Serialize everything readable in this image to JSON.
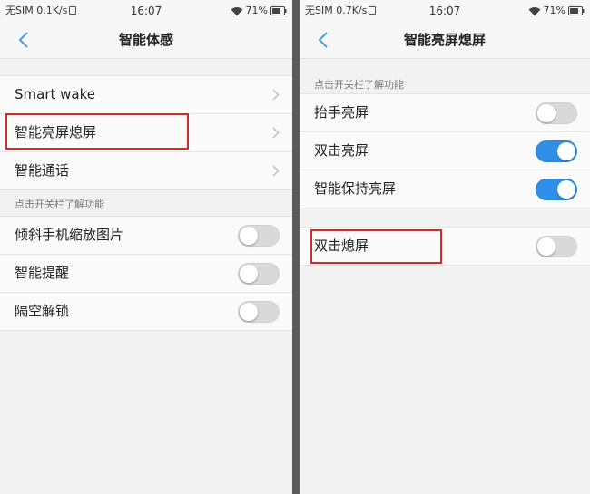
{
  "left": {
    "status": {
      "carrier": "无SIM",
      "speed": "0.1K/s",
      "time": "16:07",
      "battery": "71%"
    },
    "title": "智能体感",
    "group1": [
      {
        "label": "Smart wake"
      },
      {
        "label": "智能亮屏熄屏"
      },
      {
        "label": "智能通话"
      }
    ],
    "section_header": "点击开关栏了解功能",
    "group2": [
      {
        "label": "倾斜手机缩放图片",
        "on": false
      },
      {
        "label": "智能提醒",
        "on": false
      },
      {
        "label": "隔空解锁",
        "on": false
      }
    ]
  },
  "right": {
    "status": {
      "carrier": "无SIM",
      "speed": "0.7K/s",
      "time": "16:07",
      "battery": "71%"
    },
    "title": "智能亮屏熄屏",
    "section_header": "点击开关栏了解功能",
    "group1": [
      {
        "label": "抬手亮屏",
        "on": false
      },
      {
        "label": "双击亮屏",
        "on": true
      },
      {
        "label": "智能保持亮屏",
        "on": true
      }
    ],
    "group2": [
      {
        "label": "双击熄屏",
        "on": false
      }
    ]
  },
  "colors": {
    "accent": "#2f8fe8",
    "highlight": "#d12b2b",
    "back_arrow": "#4a9fd8"
  },
  "icons": [
    "back-arrow-icon",
    "chevron-right-icon",
    "wifi-icon",
    "battery-icon",
    "sim-icon"
  ]
}
